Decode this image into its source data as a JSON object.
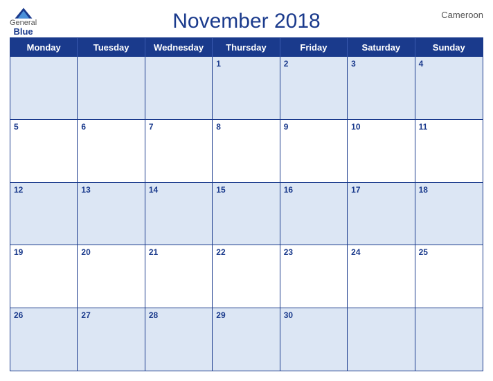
{
  "header": {
    "logo": {
      "general": "General",
      "blue": "Blue"
    },
    "title": "November 2018",
    "country": "Cameroon"
  },
  "weekdays": [
    "Monday",
    "Tuesday",
    "Wednesday",
    "Thursday",
    "Friday",
    "Saturday",
    "Sunday"
  ],
  "weeks": [
    [
      null,
      null,
      null,
      1,
      2,
      3,
      4
    ],
    [
      5,
      6,
      7,
      8,
      9,
      10,
      11
    ],
    [
      12,
      13,
      14,
      15,
      16,
      17,
      18
    ],
    [
      19,
      20,
      21,
      22,
      23,
      24,
      25
    ],
    [
      26,
      27,
      28,
      29,
      30,
      null,
      null
    ]
  ]
}
